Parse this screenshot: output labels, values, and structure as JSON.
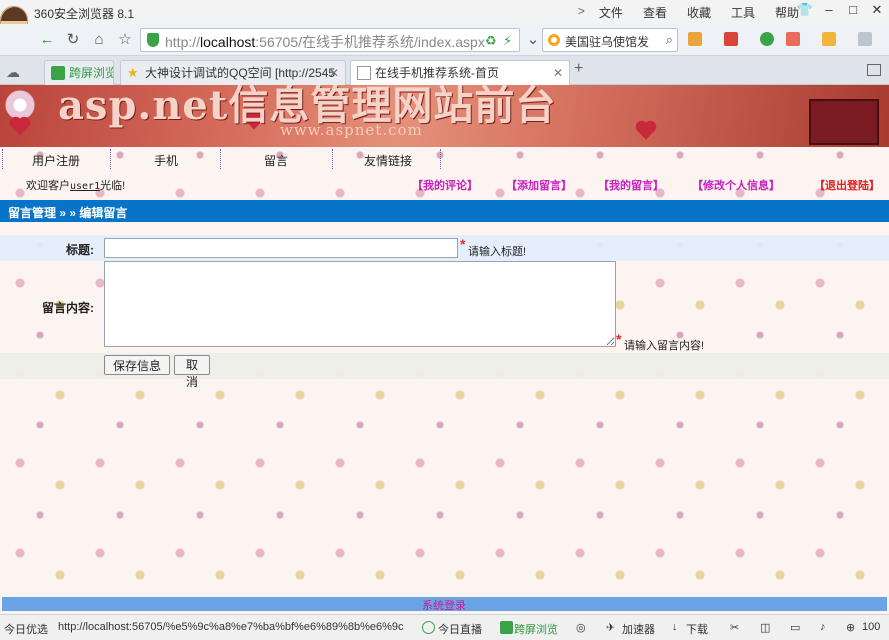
{
  "browser": {
    "title": "360安全浏览器 8.1",
    "menu": [
      "文件",
      "查看",
      "收藏",
      "工具",
      "帮助"
    ],
    "menu_chevron": ">",
    "url_prefix": "http://",
    "url_host": "localhost",
    "url_rest": ":56705/在线手机推荐系统/index.aspx",
    "search_text": "美国驻乌使馆发",
    "tabs": [
      {
        "label": "跨屏浏览"
      },
      {
        "label": "大神设计调试的QQ空间 [http://2545"
      },
      {
        "label": "在线手机推荐系统-首页"
      }
    ],
    "new_tab": "+",
    "colors": {
      "chrome": "#eef1f5",
      "accent_green": "#3aa347"
    }
  },
  "banner": {
    "title": "asp.net信息管理网站前台",
    "subtitle": "www.aspnet.com"
  },
  "nav": {
    "items": [
      "用户注册",
      "手机",
      "留言",
      "友情链接"
    ]
  },
  "welcome": {
    "prefix": "欢迎客户",
    "username": "user1",
    "suffix": "光临!"
  },
  "user_links": [
    {
      "label": "【我的评论】",
      "color": "#c81fbf"
    },
    {
      "label": "【添加留言】",
      "color": "#c81fbf"
    },
    {
      "label": "【我的留言】",
      "color": "#c81fbf"
    },
    {
      "label": "【修改个人信息】",
      "color": "#c81fbf"
    },
    {
      "label": "【退出登陆】",
      "color": "#e01f1f"
    }
  ],
  "breadcrumb": "留言管理 » » 编辑留言",
  "form": {
    "title_label": "标题:",
    "title_value": "",
    "title_hint": "请输入标题!",
    "content_label": "留言内容:",
    "content_value": "",
    "content_hint": "请输入留言内容!",
    "required_mark": "*",
    "save_label": "保存信息",
    "cancel_label": "取消"
  },
  "footer": {
    "label": "系统登录"
  },
  "status": {
    "left": "今日优选",
    "url": "http://localhost:56705/%e5%9c%a8%e7%ba%bf%e6%89%8b%e6%9c",
    "live": "今日直播",
    "cross": "跨屏浏览",
    "accelerate": "加速器",
    "download": "下载",
    "zoom": "100"
  }
}
